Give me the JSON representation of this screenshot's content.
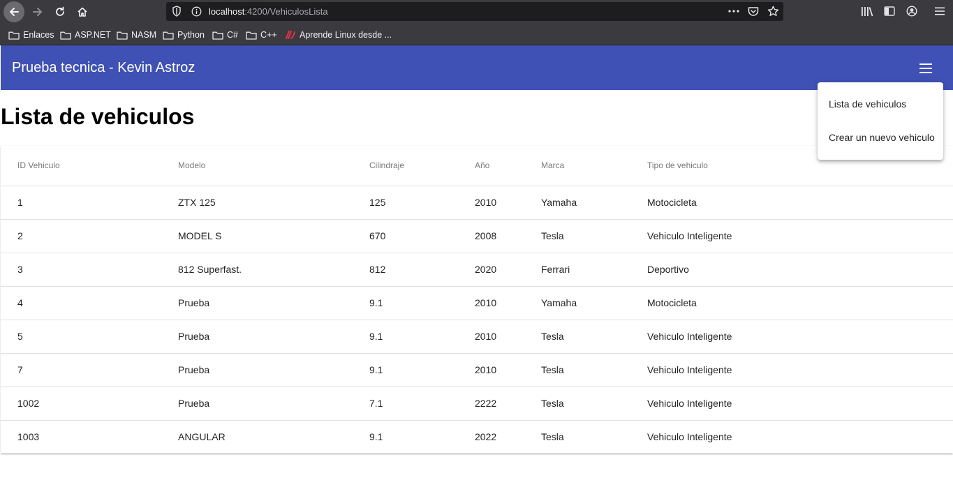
{
  "browser": {
    "url_host": "localhost",
    "url_path": ":4200/VehiculosLista",
    "bookmarks": [
      {
        "label": "Enlaces",
        "icon": "folder-icon"
      },
      {
        "label": "ASP.NET",
        "icon": "folder-icon"
      },
      {
        "label": "NASM",
        "icon": "folder-icon"
      },
      {
        "label": "Python",
        "icon": "folder-icon"
      },
      {
        "label": "C#",
        "icon": "folder-icon"
      },
      {
        "label": "C++",
        "icon": "folder-icon"
      },
      {
        "label": "Aprende Linux desde ...",
        "icon": "site-favicon-icon"
      }
    ]
  },
  "app": {
    "title": "Prueba tecnica - Kevin Astroz",
    "primary_color": "#3f51b5",
    "menu_icon": "hamburger-menu-icon"
  },
  "page": {
    "title": "Lista de vehiculos"
  },
  "table": {
    "headers": [
      "ID Vehiculo",
      "Modelo",
      "Cilindraje",
      "Año",
      "Marca",
      "Tipo de vehiculo"
    ],
    "rows": [
      [
        "1",
        "ZTX 125",
        "125",
        "2010",
        "Yamaha",
        "Motocicleta"
      ],
      [
        "2",
        "MODEL S",
        "670",
        "2008",
        "Tesla",
        "Vehiculo Inteligente"
      ],
      [
        "3",
        "812 Superfast.",
        "812",
        "2020",
        "Ferrari",
        "Deportivo"
      ],
      [
        "4",
        "Prueba",
        "9.1",
        "2010",
        "Yamaha",
        "Motocicleta"
      ],
      [
        "5",
        "Prueba",
        "9.1",
        "2010",
        "Tesla",
        "Vehiculo Inteligente"
      ],
      [
        "7",
        "Prueba",
        "9.1",
        "2010",
        "Tesla",
        "Vehiculo Inteligente"
      ],
      [
        "1002",
        "Prueba",
        "7.1",
        "2222",
        "Tesla",
        "Vehiculo Inteligente"
      ],
      [
        "1003",
        "ANGULAR",
        "9.1",
        "2022",
        "Tesla",
        "Vehiculo Inteligente"
      ]
    ]
  },
  "menu": {
    "items": [
      "Lista de vehiculos",
      "Crear un nuevo vehiculo"
    ]
  }
}
